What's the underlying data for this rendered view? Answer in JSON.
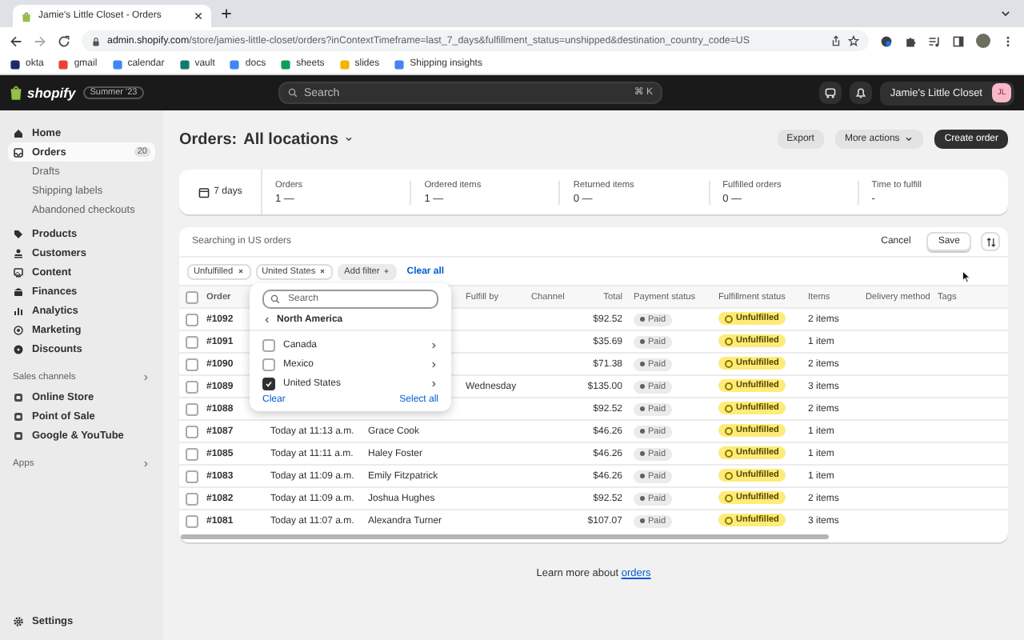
{
  "browser": {
    "tab_title": "Jamie's Little Closet - Orders",
    "url_host": "admin.shopify.com",
    "url_path": "/store/jamies-little-closet/orders?inContextTimeframe=last_7_days&fulfillment_status=unshipped&destination_country_code=US",
    "bookmarks": [
      {
        "label": "okta",
        "color": "#1f2a6b"
      },
      {
        "label": "gmail",
        "color": "#ea4335"
      },
      {
        "label": "calendar",
        "color": "#4285f4"
      },
      {
        "label": "vault",
        "color": "#0f7b6c"
      },
      {
        "label": "docs",
        "color": "#4285f4"
      },
      {
        "label": "sheets",
        "color": "#0f9d58"
      },
      {
        "label": "slides",
        "color": "#f4b400"
      },
      {
        "label": "Shipping insights",
        "color": "#4285f4"
      }
    ]
  },
  "topbar": {
    "logo": "shopify",
    "edition": "Summer '23",
    "search": {
      "placeholder": "Search",
      "shortcut": "⌘ K"
    },
    "store": "Jamie's Little Closet",
    "avatar": "JL"
  },
  "sidebar": {
    "items": [
      {
        "label": "Home",
        "selected": false
      },
      {
        "label": "Orders",
        "selected": true,
        "badge": "20",
        "children": [
          {
            "label": "Drafts",
            "selected": false
          },
          {
            "label": "Shipping labels",
            "selected": false
          },
          {
            "label": "Abandoned checkouts",
            "selected": false
          }
        ]
      },
      {
        "label": "Products",
        "selected": false
      },
      {
        "label": "Customers",
        "selected": false
      },
      {
        "label": "Content",
        "selected": false
      },
      {
        "label": "Finances",
        "selected": false
      },
      {
        "label": "Analytics",
        "selected": false
      },
      {
        "label": "Marketing",
        "selected": false
      },
      {
        "label": "Discounts",
        "selected": false
      }
    ],
    "sections": [
      {
        "title": "Sales channels",
        "items": [
          {
            "label": "Online Store",
            "selected": false
          },
          {
            "label": "Point of Sale",
            "selected": false
          },
          {
            "label": "Google & YouTube",
            "selected": false
          }
        ]
      },
      {
        "title": "Apps"
      }
    ],
    "settings": "Settings"
  },
  "page": {
    "title": "Orders:",
    "location": "All locations",
    "actions": [
      {
        "label": "Export",
        "kind": "secondary"
      },
      {
        "label": "More actions",
        "kind": "menu"
      },
      {
        "label": "Create order",
        "kind": "primary"
      }
    ]
  },
  "stats": {
    "period": "7 days",
    "metrics": [
      {
        "label": "Orders",
        "value": "1 —"
      },
      {
        "label": "Ordered items",
        "value": "1 —"
      },
      {
        "label": "Returned items",
        "value": "0 —"
      },
      {
        "label": "Fulfilled orders",
        "value": "0 —"
      },
      {
        "label": "Time to fulfill",
        "value": "-"
      }
    ]
  },
  "table": {
    "search_hint": "Searching in US orders",
    "cancel": "Cancel",
    "save": "Save",
    "filters": [
      {
        "label": "Unfulfilled"
      },
      {
        "label": "United States"
      }
    ],
    "add_filter": "Add filter",
    "clear_all": "Clear all",
    "select_all": {
      "checked": false
    },
    "columns": [
      {
        "kind": "order",
        "label": "Order"
      },
      {
        "kind": "date"
      },
      {
        "kind": "customer"
      },
      {
        "kind": "fulfill_by",
        "label": "Fulfill by"
      },
      {
        "kind": "channel",
        "label": "Channel"
      },
      {
        "kind": "total",
        "label": "Total"
      },
      {
        "kind": "payment",
        "label": "Payment status"
      },
      {
        "kind": "fulfillment",
        "label": "Fulfillment status"
      },
      {
        "kind": "items",
        "label": "Items"
      },
      {
        "kind": "delivery",
        "label": "Delivery method"
      },
      {
        "kind": "tags",
        "label": "Tags"
      }
    ],
    "rows": [
      {
        "checked": false,
        "order": "#1092",
        "total": "$92.52",
        "payment": "Paid",
        "fulfillment": "Unfulfilled",
        "items": "2 items"
      },
      {
        "checked": false,
        "order": "#1091",
        "total": "$35.69",
        "payment": "Paid",
        "fulfillment": "Unfulfilled",
        "items": "1 item"
      },
      {
        "checked": false,
        "order": "#1090",
        "total": "$71.38",
        "payment": "Paid",
        "fulfillment": "Unfulfilled",
        "items": "2 items"
      },
      {
        "checked": false,
        "order": "#1089",
        "fulfill_by": "Wednesday",
        "total": "$135.00",
        "payment": "Paid",
        "fulfillment": "Unfulfilled",
        "items": "3 items"
      },
      {
        "checked": false,
        "order": "#1088",
        "total": "$92.52",
        "payment": "Paid",
        "fulfillment": "Unfulfilled",
        "items": "2 items"
      },
      {
        "checked": false,
        "order": "#1087",
        "date": "Today at 11:13 a.m.",
        "customer": "Grace Cook",
        "total": "$46.26",
        "payment": "Paid",
        "fulfillment": "Unfulfilled",
        "items": "1 item"
      },
      {
        "checked": false,
        "order": "#1085",
        "date": "Today at 11:11 a.m.",
        "customer": "Haley Foster",
        "total": "$46.26",
        "payment": "Paid",
        "fulfillment": "Unfulfilled",
        "items": "1 item"
      },
      {
        "checked": false,
        "order": "#1083",
        "date": "Today at 11:09 a.m.",
        "customer": "Emily Fitzpatrick",
        "total": "$46.26",
        "payment": "Paid",
        "fulfillment": "Unfulfilled",
        "items": "1 item"
      },
      {
        "checked": false,
        "order": "#1082",
        "date": "Today at 11:09 a.m.",
        "customer": "Joshua Hughes",
        "total": "$92.52",
        "payment": "Paid",
        "fulfillment": "Unfulfilled",
        "items": "2 items"
      },
      {
        "checked": false,
        "order": "#1081",
        "date": "Today at 11:07 a.m.",
        "customer": "Alexandra Turner",
        "total": "$107.07",
        "payment": "Paid",
        "fulfillment": "Unfulfilled",
        "items": "3 items"
      }
    ],
    "popover": {
      "search_placeholder": "Search",
      "region": "North America",
      "options": [
        {
          "label": "Canada",
          "checked": false
        },
        {
          "label": "Mexico",
          "checked": false
        },
        {
          "label": "United States",
          "checked": true
        }
      ],
      "clear": "Clear",
      "select_all": "Select all"
    }
  },
  "footer": {
    "text": "Learn more about",
    "link": "orders"
  }
}
